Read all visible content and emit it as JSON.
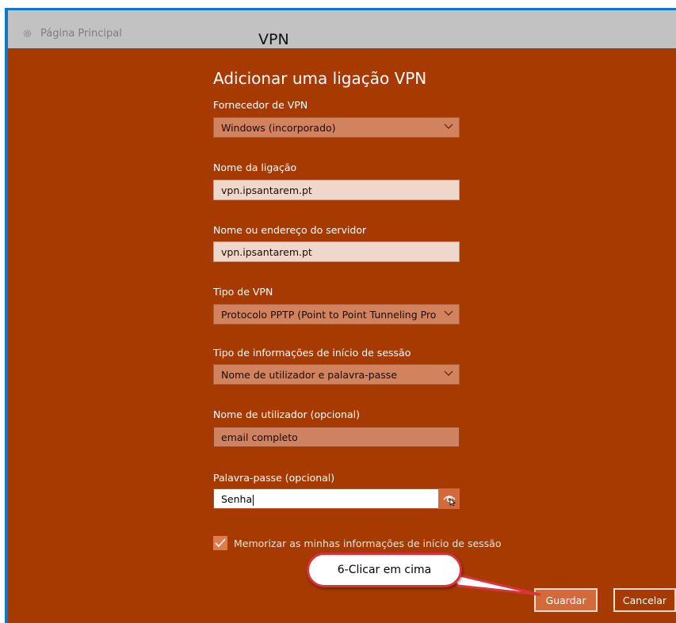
{
  "window": {
    "home_label": "Página Principal",
    "title": "VPN"
  },
  "form": {
    "heading": "Adicionar uma ligação VPN",
    "provider": {
      "label": "Fornecedor de VPN",
      "value": "Windows (incorporado)"
    },
    "connection_name": {
      "label": "Nome da ligação",
      "value": "vpn.ipsantarem.pt"
    },
    "server": {
      "label": "Nome ou endereço do servidor",
      "value": "vpn.ipsantarem.pt"
    },
    "vpn_type": {
      "label": "Tipo de VPN",
      "value": "Protocolo PPTP (Point to Point Tunneling Pro"
    },
    "signin_type": {
      "label": "Tipo de informações de início de sessão",
      "value": "Nome de utilizador e palavra-passe"
    },
    "username": {
      "label": "Nome de utilizador (opcional)",
      "value": "email completo"
    },
    "password": {
      "label": "Palavra-passe (opcional)",
      "value": "Senha"
    },
    "remember": {
      "label": "Memorizar as minhas informações de início de sessão",
      "checked": true
    }
  },
  "buttons": {
    "save": "Guardar",
    "cancel": "Cancelar"
  },
  "annotation": {
    "callout_text": "6-Clicar em cima",
    "border_color": "#d9333b"
  },
  "colors": {
    "background": "#a63a00",
    "frame": "#0b78c9",
    "titlebar": "#c2c2c2",
    "accent": "#d26a3c"
  }
}
